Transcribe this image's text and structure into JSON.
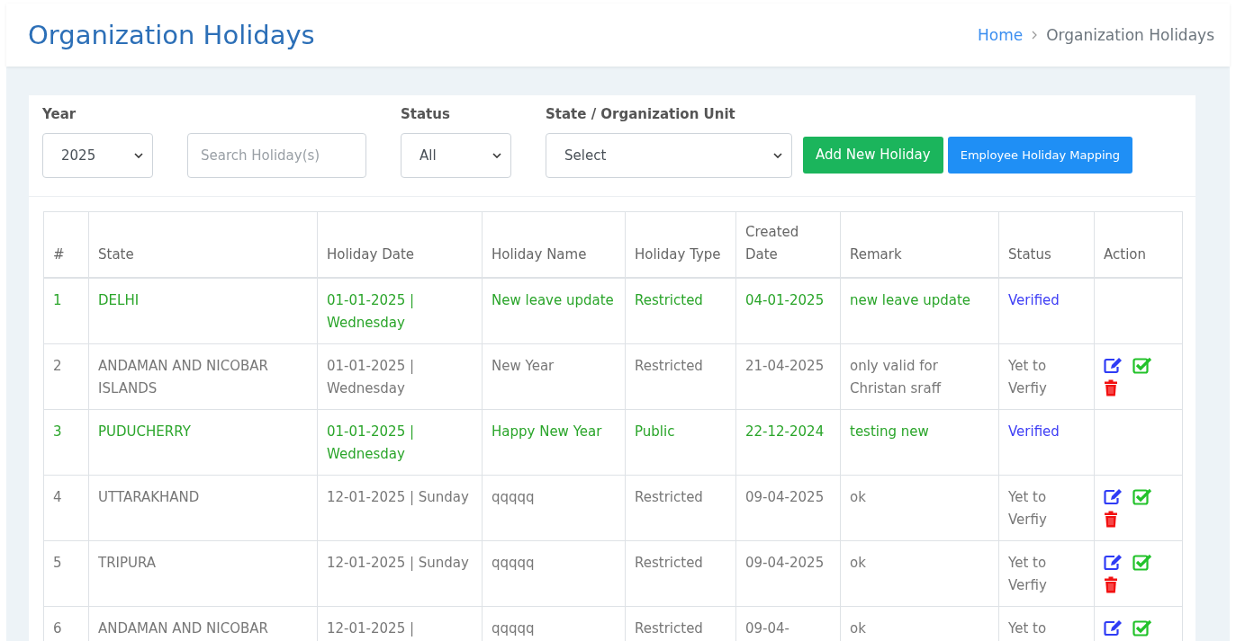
{
  "page": {
    "title": "Organization Holidays"
  },
  "breadcrumb": [
    {
      "label": "Home",
      "kind": "link"
    },
    {
      "label": "Organization Holidays",
      "kind": "current"
    }
  ],
  "filters": {
    "year": {
      "label": "Year",
      "value": "2025"
    },
    "search": {
      "placeholder": "Search Holiday(s)"
    },
    "status": {
      "label": "Status",
      "value": "All"
    },
    "unit": {
      "label": "State / Organization Unit",
      "value": "Select"
    }
  },
  "buttons": [
    {
      "label": "Add New Holiday",
      "kind": "primary"
    },
    {
      "label": "Employee Holiday Mapping",
      "kind": "secondary"
    }
  ],
  "table": {
    "columns": [
      "#",
      "State",
      "Holiday Date",
      "Holiday Name",
      "Holiday Type",
      "Created Date",
      "Remark",
      "Status",
      "Action"
    ],
    "rows": [
      {
        "cells": [
          "1",
          "DELHI",
          "01-01-2025 | Wednesday",
          "New leave update",
          "Restricted",
          "04-01-2025",
          "new leave update",
          "Verified"
        ],
        "verified": true,
        "can_edit": false,
        "can_verify": false,
        "can_delete": false
      },
      {
        "cells": [
          "2",
          "ANDAMAN AND NICOBAR ISLANDS",
          "01-01-2025 | Wednesday",
          "New Year",
          "Restricted",
          "21-04-2025",
          "only valid for Christan sraff",
          "Yet to Verfiy"
        ],
        "verified": false,
        "can_edit": true,
        "can_verify": true,
        "can_delete": true
      },
      {
        "cells": [
          "3",
          "PUDUCHERRY",
          "01-01-2025 | Wednesday",
          "Happy New Year",
          "Public",
          "22-12-2024",
          "testing new",
          "Verified"
        ],
        "verified": true,
        "can_edit": false,
        "can_verify": false,
        "can_delete": false
      },
      {
        "cells": [
          "4",
          "UTTARAKHAND",
          "12-01-2025 | Sunday",
          "qqqqq",
          "Restricted",
          "09-04-2025",
          "ok",
          "Yet to Verfiy"
        ],
        "verified": false,
        "can_edit": true,
        "can_verify": true,
        "can_delete": true
      },
      {
        "cells": [
          "5",
          "TRIPURA",
          "12-01-2025 | Sunday",
          "qqqqq",
          "Restricted",
          "09-04-2025",
          "ok",
          "Yet to Verfiy"
        ],
        "verified": false,
        "can_edit": true,
        "can_verify": true,
        "can_delete": true
      },
      {
        "cells": [
          "6",
          "ANDAMAN AND NICOBAR",
          "12-01-2025 |",
          "qqqqq",
          "Restricted",
          "09-04-",
          "ok",
          "Yet to"
        ],
        "verified": false,
        "can_edit": true,
        "can_verify": true,
        "can_delete": false
      }
    ]
  }
}
